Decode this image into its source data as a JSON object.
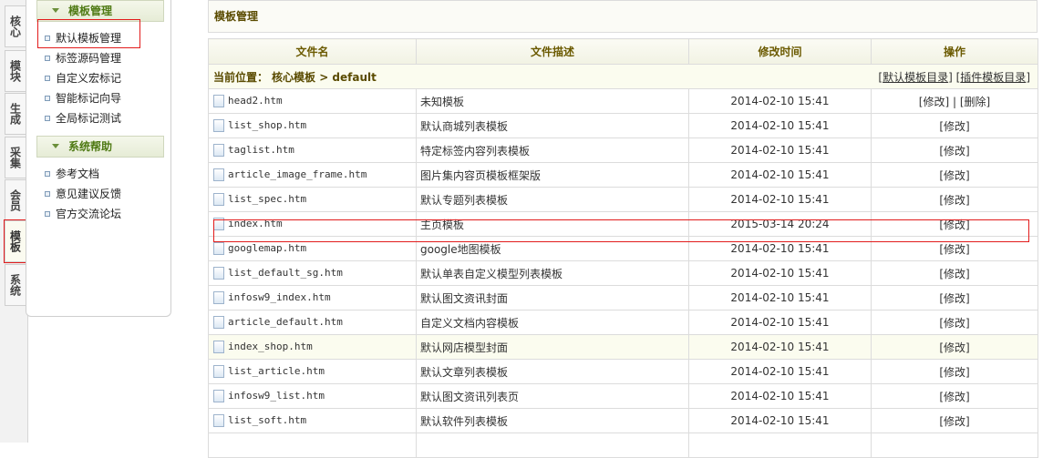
{
  "vtabs": [
    "核心",
    "模块",
    "生成",
    "采集",
    "会员",
    "模板",
    "系统"
  ],
  "menu": {
    "section1": "模板管理",
    "items1": [
      "默认模板管理",
      "标签源码管理",
      "自定义宏标记",
      "智能标记向导",
      "全局标记测试"
    ],
    "section2": "系统帮助",
    "items2": [
      "参考文档",
      "意见建议反馈",
      "官方交流论坛"
    ]
  },
  "panel": {
    "title": "模板管理"
  },
  "table": {
    "headers": [
      "文件名",
      "文件描述",
      "修改时间",
      "操作"
    ],
    "location_label": "当前位置：",
    "location_path": "核心模板 > default",
    "links": {
      "default_dir": "默认模板目录",
      "plugin_dir": "插件模板目录"
    },
    "edit": "[修改]",
    "delete": "[删除]",
    "rows": [
      {
        "file": "head2.htm",
        "desc": "未知模板",
        "time": "2014-02-10 15:41"
      },
      {
        "file": "list_shop.htm",
        "desc": "默认商城列表模板",
        "time": "2014-02-10 15:41"
      },
      {
        "file": "taglist.htm",
        "desc": "特定标签内容列表模板",
        "time": "2014-02-10 15:41"
      },
      {
        "file": "article_image_frame.htm",
        "desc": "图片集内容页模板框架版",
        "time": "2014-02-10 15:41"
      },
      {
        "file": "list_spec.htm",
        "desc": "默认专题列表模板",
        "time": "2014-02-10 15:41"
      },
      {
        "file": "index.htm",
        "desc": "主页模板",
        "time": "2015-03-14 20:24"
      },
      {
        "file": "googlemap.htm",
        "desc": "google地图模板",
        "time": "2014-02-10 15:41"
      },
      {
        "file": "list_default_sg.htm",
        "desc": "默认单表自定义模型列表模板",
        "time": "2014-02-10 15:41"
      },
      {
        "file": "infosw9_index.htm",
        "desc": "默认图文资讯封面",
        "time": "2014-02-10 15:41"
      },
      {
        "file": "article_default.htm",
        "desc": "自定义文档内容模板",
        "time": "2014-02-10 15:41"
      },
      {
        "file": "index_shop.htm",
        "desc": "默认网店模型封面",
        "time": "2014-02-10 15:41"
      },
      {
        "file": "list_article.htm",
        "desc": "默认文章列表模板",
        "time": "2014-02-10 15:41"
      },
      {
        "file": "infosw9_list.htm",
        "desc": "默认图文资讯列表页",
        "time": "2014-02-10 15:41"
      },
      {
        "file": "list_soft.htm",
        "desc": "默认软件列表模板",
        "time": "2014-02-10 15:41"
      },
      {
        "file": "",
        "desc": "",
        "time": ""
      }
    ]
  }
}
